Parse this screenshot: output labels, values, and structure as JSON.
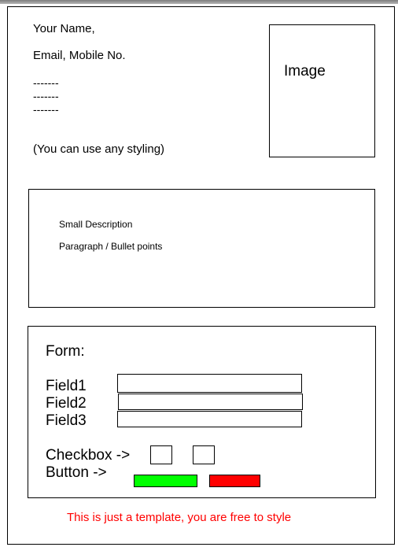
{
  "header": {
    "name_line": "Your Name,",
    "contact_line": "Email, Mobile No.",
    "dashes": [
      "-------",
      "-------",
      "-------"
    ],
    "styling_note": "(You can use any styling)"
  },
  "image_box": {
    "label": "Image"
  },
  "description": {
    "title": "Small Description",
    "body": "Paragraph / Bullet points"
  },
  "form": {
    "title": "Form:",
    "fields": [
      {
        "label": "Field1",
        "value": ""
      },
      {
        "label": "Field2",
        "value": ""
      },
      {
        "label": "Field3",
        "value": ""
      }
    ],
    "checkbox_label": "Checkbox ->",
    "button_label": "Button ->"
  },
  "footer": {
    "note": "This is just a template, you are free to style"
  },
  "colors": {
    "primary_button": "#00ff00",
    "secondary_button": "#ff0000",
    "footer_text": "#ff0000",
    "frame": "#000000"
  }
}
